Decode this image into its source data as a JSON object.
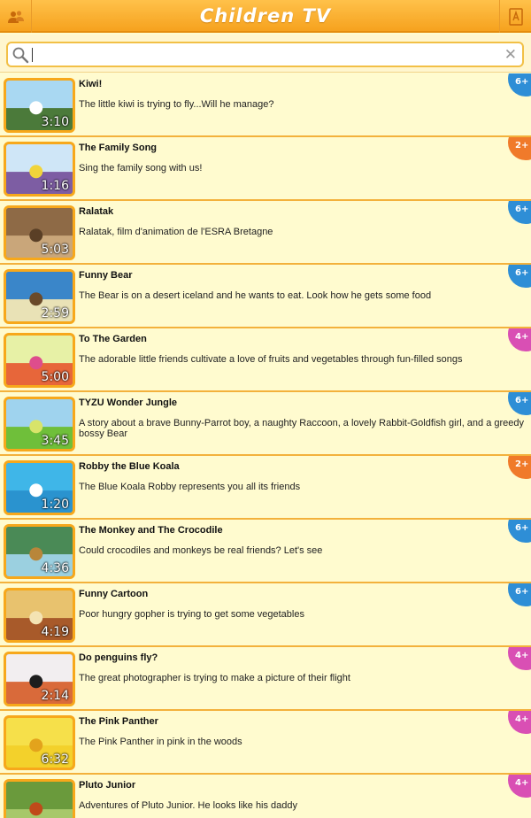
{
  "app": {
    "title": "Children TV"
  },
  "search": {
    "value": "",
    "placeholder": ""
  },
  "colors": {
    "age_6": "#2e8ed6",
    "age_2": "#f07a2a",
    "age_4": "#d94fb4"
  },
  "videos": [
    {
      "title": "Kiwi!",
      "description": "The little kiwi is trying to fly...Will he manage?",
      "duration": "3:10",
      "age": "6+",
      "thumb": [
        "#a9d8f2",
        "#4b7a3a",
        "#ffffff"
      ]
    },
    {
      "title": "The Family Song",
      "description": "Sing the family song with us!",
      "duration": "1:16",
      "age": "2+",
      "thumb": [
        "#cfe6f7",
        "#7d5da3",
        "#f1d43a"
      ]
    },
    {
      "title": "Ralatak",
      "description": "Ralatak, film d'animation de l'ESRA Bretagne",
      "duration": "5:03",
      "age": "6+",
      "thumb": [
        "#8e6a46",
        "#c9a67a",
        "#5a3f26"
      ]
    },
    {
      "title": "Funny Bear",
      "description": "The Bear is on a desert iceland and he wants to eat. Look how he gets some food",
      "duration": "2:59",
      "age": "6+",
      "thumb": [
        "#3a86c9",
        "#e9e2b6",
        "#6a4a2a"
      ]
    },
    {
      "title": "To The Garden",
      "description": "The adorable little friends cultivate a love of fruits and vegetables through fun-filled songs",
      "duration": "5:00",
      "age": "4+",
      "thumb": [
        "#e7f1a6",
        "#e7663a",
        "#de4d8c"
      ]
    },
    {
      "title": "TYZU Wonder Jungle",
      "description": "A story about a brave Bunny-Parrot boy, a naughty Raccoon, a lovely Rabbit-Goldfish girl, and a greedy bossy Bear",
      "duration": "3:45",
      "age": "6+",
      "thumb": [
        "#9fd3ee",
        "#6fbf3a",
        "#d8e46a"
      ]
    },
    {
      "title": "Robby the Blue Koala",
      "description": "The Blue Koala Robby represents you all its friends",
      "duration": "1:20",
      "age": "2+",
      "thumb": [
        "#3fb6e8",
        "#2a93cf",
        "#ffffff"
      ]
    },
    {
      "title": "The Monkey and The Crocodile",
      "description": "Could crocodiles and monkeys be real friends? Let's see",
      "duration": "4:36",
      "age": "6+",
      "thumb": [
        "#4a8a56",
        "#9bd0e0",
        "#b8863a"
      ]
    },
    {
      "title": "Funny Cartoon",
      "description": "Poor hungry gopher is trying to get some vegetables",
      "duration": "4:19",
      "age": "6+",
      "thumb": [
        "#e8c26e",
        "#a85a2a",
        "#f4e3b3"
      ]
    },
    {
      "title": "Do penguins fly?",
      "description": "The great photographer is trying to make a picture of their flight",
      "duration": "2:14",
      "age": "4+",
      "thumb": [
        "#f2eef0",
        "#d96a3a",
        "#1d1d1d"
      ]
    },
    {
      "title": "The Pink Panther",
      "description": "The Pink Panther in pink in the woods",
      "duration": "6:32",
      "age": "4+",
      "thumb": [
        "#f6e04a",
        "#f3d12b",
        "#e3a31c"
      ]
    },
    {
      "title": "Pluto Junior",
      "description": "Adventures of Pluto Junior. He looks like his daddy",
      "duration": "",
      "age": "4+",
      "thumb": [
        "#6a9a3c",
        "#a7c86a",
        "#c04a1a"
      ]
    }
  ]
}
